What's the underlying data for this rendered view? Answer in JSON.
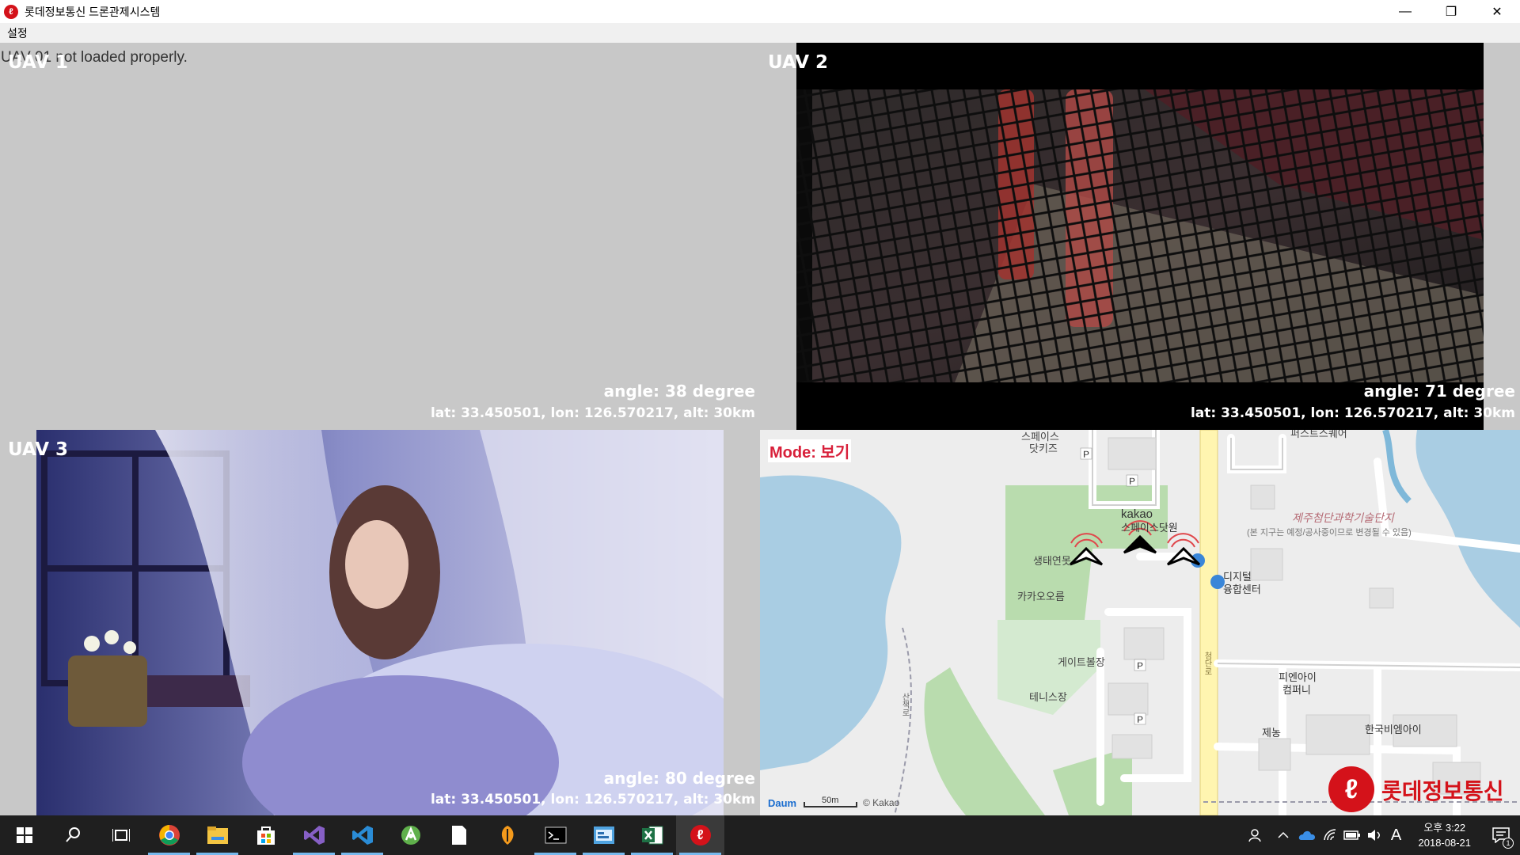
{
  "window": {
    "title": "롯데정보통신 드론관제시스템",
    "controls": {
      "minimize": "—",
      "maximize": "❐",
      "close": "✕"
    }
  },
  "menu": {
    "items": [
      "설정"
    ]
  },
  "uav1": {
    "label": "UAV 1",
    "error": "UAV 01 not loaded properly.",
    "angle": "angle: 38 degree",
    "position": "lat: 33.450501, lon: 126.570217, alt: 30km"
  },
  "uav2": {
    "label": "UAV 2",
    "angle": "angle: 71 degree",
    "position": "lat: 33.450501, lon: 126.570217, alt: 30km"
  },
  "uav3": {
    "label": "UAV 3",
    "angle": "angle: 80 degree",
    "position": "lat: 33.450501, lon: 126.570217, alt: 30km"
  },
  "map": {
    "mode": "Mode: 보기",
    "labels": {
      "top_left_a": "생태연못",
      "kakao_ore": "카카오오름",
      "kakao": "kakao",
      "space_dot_one": "스페이스닷원",
      "gate": "게이트볼장",
      "tennis": "테니스장",
      "space_dots_top": "스페이스",
      "dot_kids": "닷키즈",
      "science_park": "제주첨단과학기술단지",
      "science_park_note": "(본 지구는 예정/공사중이므로 변경될 수 있음)",
      "digital": "디지털",
      "complex": "융합센터",
      "pnic": "피엔아이",
      "company": "컴퍼니",
      "jenong": "제농",
      "korea_bm": "한국비엠아이",
      "first_tower": "퍼스트스퀘어",
      "road": "첨단로",
      "pathway": "산책로",
      "scale": "50m",
      "copyright": "© Kakao",
      "daum_logo": "Daum",
      "company_logo": "롯데정보통신"
    }
  },
  "taskbar": {
    "apps": [
      "start-icon",
      "search-icon",
      "task-view-icon",
      "chrome-icon",
      "file-explorer-icon",
      "store-icon",
      "visual-studio-icon",
      "vscode-icon",
      "android-studio-icon",
      "notepad-icon",
      "fl-studio-icon",
      "terminal-icon",
      "control-panel-icon",
      "excel-icon",
      "lotte-app-icon"
    ],
    "time": "오후 3:22",
    "date": "2018-08-21",
    "ime": "A",
    "notification_count": "1"
  }
}
